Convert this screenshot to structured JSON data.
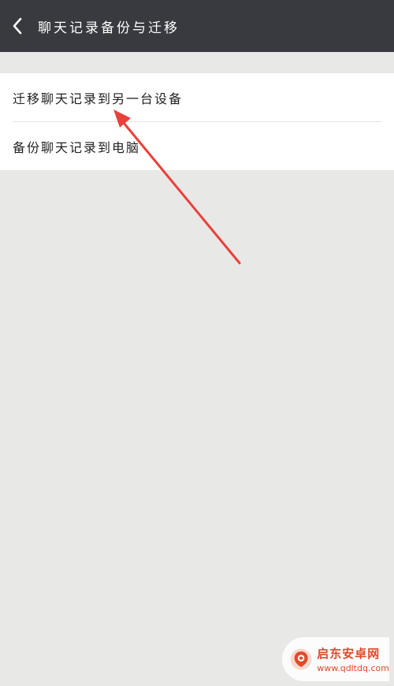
{
  "header": {
    "title": "聊天记录备份与迁移",
    "back_icon": "chevron-left-icon"
  },
  "menu": {
    "items": [
      {
        "label": "迁移聊天记录到另一台设备"
      },
      {
        "label": "备份聊天记录到电脑"
      }
    ]
  },
  "annotation": {
    "type": "red-arrow",
    "color": "#e8413b"
  },
  "watermark": {
    "name": "启东安卓网",
    "url": "www.qdltdq.com",
    "color": "#e04a2b"
  }
}
